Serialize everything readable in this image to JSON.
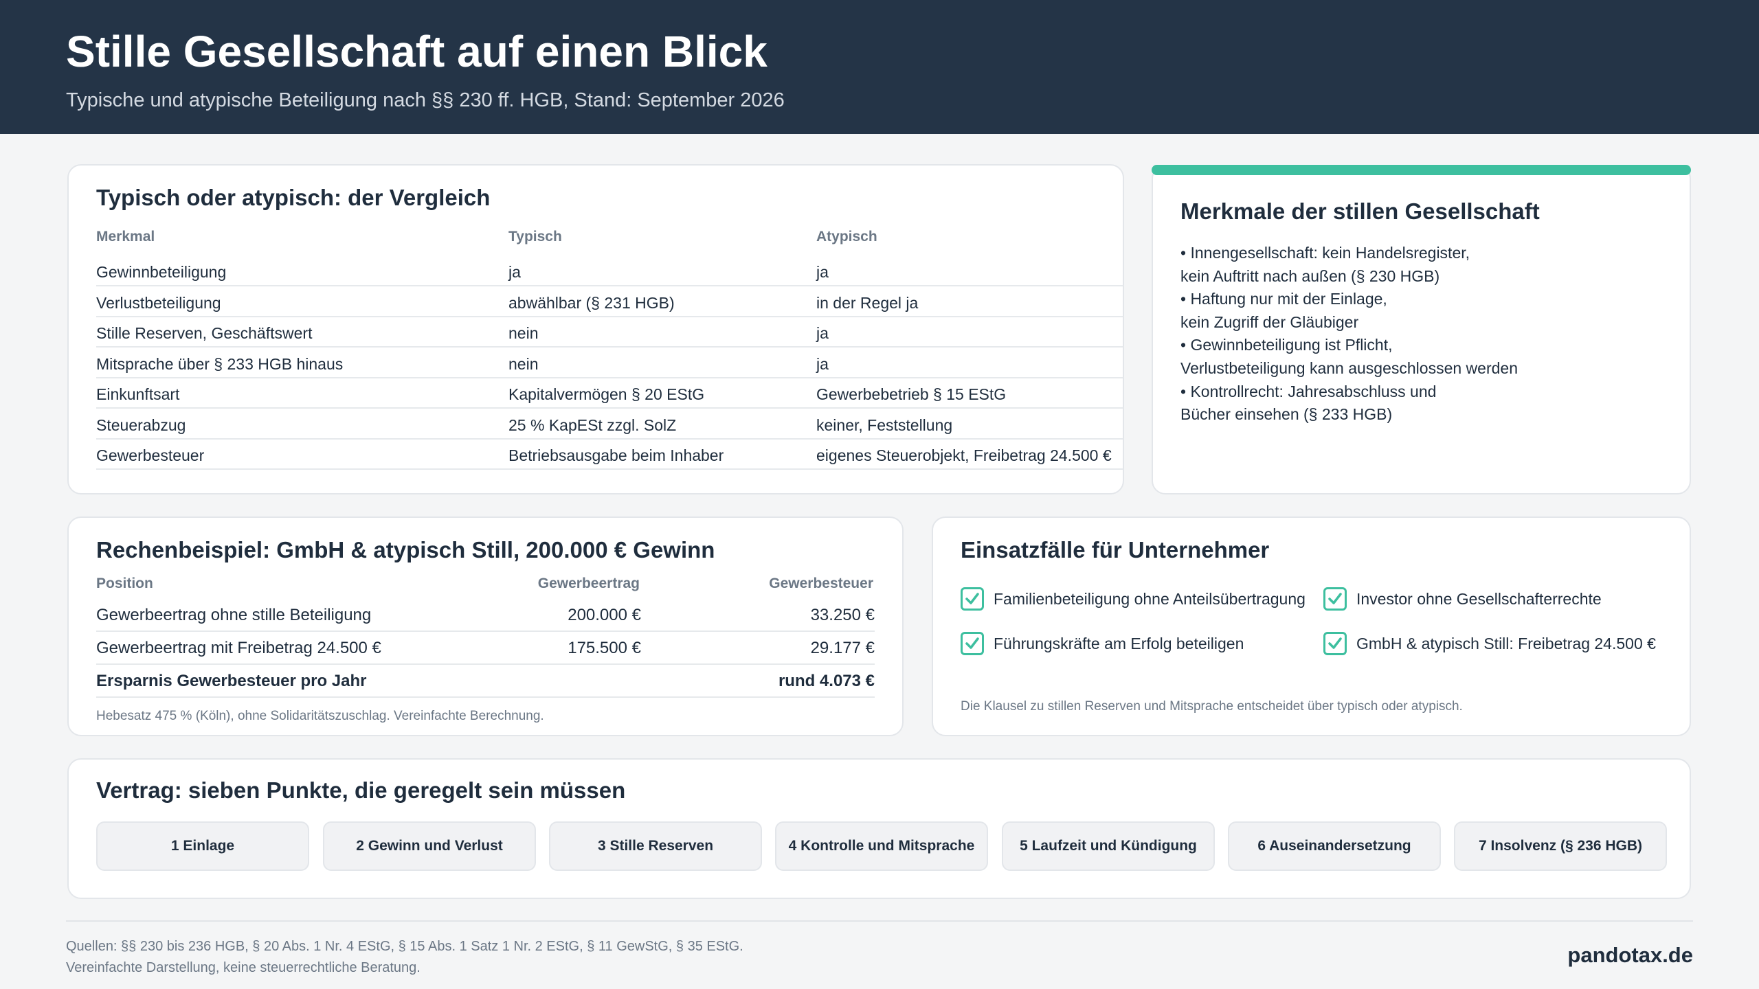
{
  "header": {
    "title": "Stille Gesellschaft auf einen Blick",
    "subtitle": "Typische und atypische Beteiligung nach §§ 230 ff. HGB, Stand: September 2026"
  },
  "comparison": {
    "title": "Typisch oder atypisch: der Vergleich",
    "columns": [
      "Merkmal",
      "Typisch",
      "Atypisch"
    ],
    "rows": [
      [
        "Gewinnbeteiligung",
        "ja",
        "ja"
      ],
      [
        "Verlustbeteiligung",
        "abwählbar (§ 231 HGB)",
        "in der Regel ja"
      ],
      [
        "Stille Reserven, Geschäftswert",
        "nein",
        "ja"
      ],
      [
        "Mitsprache über § 233 HGB hinaus",
        "nein",
        "ja"
      ],
      [
        "Einkunftsart",
        "Kapitalvermögen § 20 EStG",
        "Gewerbebetrieb § 15 EStG"
      ],
      [
        "Steuerabzug",
        "25 % KapESt zzgl. SolZ",
        "keiner, Feststellung"
      ],
      [
        "Gewerbesteuer",
        "Betriebsausgabe beim Inhaber",
        "eigenes Steuerobjekt, Freibetrag 24.500 €"
      ]
    ]
  },
  "features": {
    "title": "Merkmale der stillen Gesellschaft",
    "accent_color": "#3dbf9f",
    "lines": [
      "• Innengesellschaft: kein Handelsregister,",
      "kein Auftritt nach außen (§ 230 HGB)",
      "• Haftung nur mit der Einlage,",
      "kein Zugriff der Gläubiger",
      "• Gewinnbeteiligung ist Pflicht,",
      "Verlustbeteiligung kann ausgeschlossen werden",
      "• Kontrollrecht: Jahresabschluss und",
      "Bücher einsehen (§ 233 HGB)"
    ]
  },
  "example": {
    "title": "Rechenbeispiel: GmbH & atypisch Still, 200.000 € Gewinn",
    "columns": [
      "Position",
      "Gewerbeertrag",
      "Gewerbesteuer"
    ],
    "rows": [
      [
        "Gewerbeertrag ohne stille Beteiligung",
        "200.000 €",
        "33.250 €"
      ],
      [
        "Gewerbeertrag mit Freibetrag 24.500 €",
        "175.500 €",
        "29.177 €"
      ],
      [
        "Ersparnis Gewerbesteuer pro Jahr",
        "",
        "rund 4.073 €"
      ]
    ],
    "note": "Hebesatz 475 % (Köln), ohne Solidaritätszuschlag. Vereinfachte Berechnung."
  },
  "use_cases": {
    "title": "Einsatzfälle für Unternehmer",
    "items": [
      "Familienbeteiligung ohne Anteilsübertragung",
      "Investor ohne Gesellschafterrechte",
      "Führungskräfte am Erfolg beteiligen",
      "GmbH & atypisch Still: Freibetrag 24.500 €"
    ],
    "note": "Die Klausel zu stillen Reserven und Mitsprache entscheidet über typisch oder atypisch."
  },
  "contract": {
    "title": "Vertrag: sieben Punkte, die geregelt sein müssen",
    "points": [
      "1 Einlage",
      "2 Gewinn und Verlust",
      "3 Stille Reserven",
      "4 Kontrolle und Mitsprache",
      "5 Laufzeit und Kündigung",
      "6 Auseinandersetzung",
      "7 Insolvenz (§ 236 HGB)"
    ]
  },
  "footer": {
    "sources": "Quellen: §§ 230 bis 236 HGB, § 20 Abs. 1 Nr. 4 EStG, § 15 Abs. 1 Satz 1 Nr. 2 EStG, § 11 GewStG, § 35 EStG.",
    "disclaimer": "Vereinfachte Darstellung, keine steuerrechtliche Beratung.",
    "brand": "pandotax.de"
  }
}
